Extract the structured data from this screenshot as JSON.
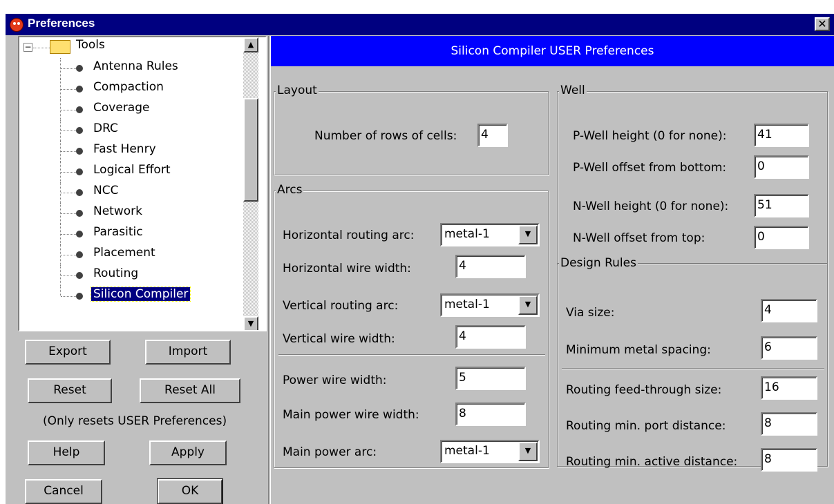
{
  "window": {
    "title": "Preferences",
    "close_glyph": "✕"
  },
  "tree": {
    "root_label": "Tools",
    "root_expander": "−",
    "items": [
      {
        "label": "Antenna Rules"
      },
      {
        "label": "Compaction"
      },
      {
        "label": "Coverage"
      },
      {
        "label": "DRC"
      },
      {
        "label": "Fast Henry"
      },
      {
        "label": "Logical Effort"
      },
      {
        "label": "NCC"
      },
      {
        "label": "Network"
      },
      {
        "label": "Parasitic"
      },
      {
        "label": "Placement"
      },
      {
        "label": "Routing"
      },
      {
        "label": "Silicon Compiler",
        "selected": true
      }
    ],
    "scroll_up": "▲",
    "scroll_down": "▼"
  },
  "buttons": {
    "export": "Export",
    "import": "Import",
    "reset": "Reset",
    "reset_all": "Reset All",
    "reset_note": "(Only resets USER Preferences)",
    "help": "Help",
    "apply": "Apply",
    "cancel": "Cancel",
    "ok": "OK"
  },
  "panel": {
    "header": "Silicon Compiler USER Preferences",
    "layout": {
      "title": "Layout",
      "rows_label": "Number of rows of cells:",
      "rows_value": "4"
    },
    "arcs": {
      "title": "Arcs",
      "h_arc_label": "Horizontal routing arc:",
      "h_arc_value": "metal-1",
      "h_width_label": "Horizontal wire width:",
      "h_width_value": "4",
      "v_arc_label": "Vertical routing arc:",
      "v_arc_value": "metal-1",
      "v_width_label": "Vertical wire width:",
      "v_width_value": "4",
      "power_width_label": "Power wire width:",
      "power_width_value": "5",
      "main_power_width_label": "Main power wire width:",
      "main_power_width_value": "8",
      "main_power_arc_label": "Main power arc:",
      "main_power_arc_value": "metal-1",
      "dropdown_arrow": "▼"
    },
    "well": {
      "title": "Well",
      "pwell_height_label": "P-Well height (0 for none):",
      "pwell_height_value": "41",
      "pwell_offset_label": "P-Well offset from bottom:",
      "pwell_offset_value": "0",
      "nwell_height_label": "N-Well height (0 for none):",
      "nwell_height_value": "51",
      "nwell_offset_label": "N-Well offset from top:",
      "nwell_offset_value": "0"
    },
    "design_rules": {
      "title": "Design Rules",
      "via_size_label": "Via size:",
      "via_size_value": "4",
      "min_spacing_label": "Minimum metal spacing:",
      "min_spacing_value": "6",
      "feedthrough_label": "Routing feed-through size:",
      "feedthrough_value": "16",
      "port_distance_label": "Routing min. port distance:",
      "port_distance_value": "8",
      "active_distance_label": "Routing min. active distance:",
      "active_distance_value": "8"
    }
  }
}
